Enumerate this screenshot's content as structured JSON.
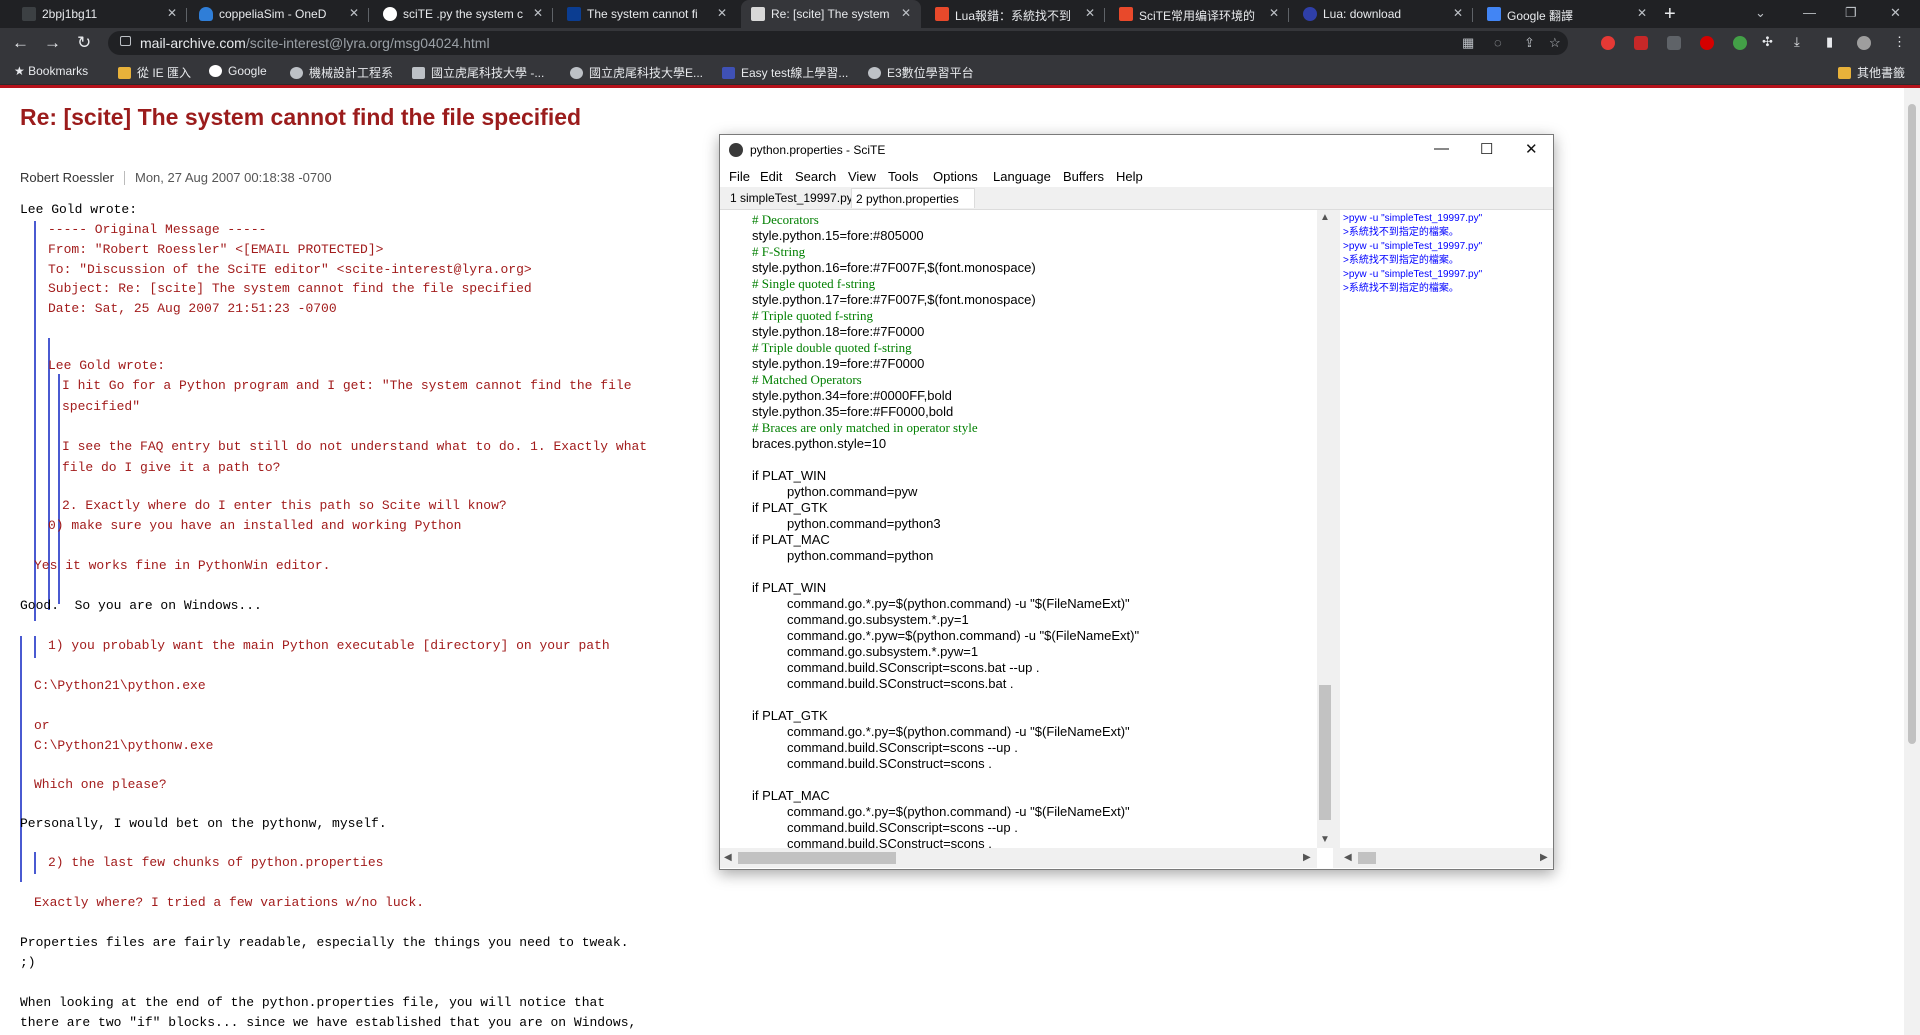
{
  "browser": {
    "tabs": [
      {
        "title": "2bpj1bg11",
        "close": "✕"
      },
      {
        "title": "coppeliaSim - OneD",
        "close": "✕"
      },
      {
        "title": "sciTE .py the system c",
        "close": "✕"
      },
      {
        "title": "The system cannot fi",
        "close": "✕"
      },
      {
        "title": "Re: [scite] The system",
        "close": "✕"
      },
      {
        "title": "Lua報錯：系統找不到",
        "close": "✕"
      },
      {
        "title": "SciTE常用编译环境的",
        "close": "✕"
      },
      {
        "title": "Lua: download",
        "close": "✕"
      },
      {
        "title": "Google 翻譯",
        "close": "✕"
      }
    ],
    "new_tab": "+",
    "url_host": "mail-archive.com",
    "url_path": "/scite-interest@lyra.org/msg04024.html",
    "bookmarks": [
      {
        "label": "Bookmarks"
      },
      {
        "label": "從 IE 匯入"
      },
      {
        "label": "Google"
      },
      {
        "label": "機械設計工程系"
      },
      {
        "label": "國立虎尾科技大學 -..."
      },
      {
        "label": "國立虎尾科技大學E..."
      },
      {
        "label": "Easy test線上學習..."
      },
      {
        "label": "E3數位學習平台"
      },
      {
        "label": "其他書籤"
      }
    ],
    "colors": {
      "chrome_dark": "#202124",
      "toolbar": "#35363a",
      "accent_red": "#b5121b"
    }
  },
  "page": {
    "title": "Re: [scite] The system cannot find the file specified",
    "author": "Robert Roessler",
    "date": "Mon, 27 Aug 2007 00:18:38 -0700",
    "lines": [
      "Lee Gold wrote:",
      "----- Original Message -----",
      "From: \"Robert Roessler\" <[EMAIL PROTECTED]>",
      "To: \"Discussion of the SciTE editor\" <scite-interest@lyra.org>",
      "Subject: Re: [scite] The system cannot find the file specified",
      "Date: Sat, 25 Aug 2007 21:51:23 -0700",
      "Lee Gold wrote:",
      "I hit Go for a Python program and I get: \"The system cannot find the file",
      "specified\"",
      "I see the FAQ entry but still do not understand what to do. 1. Exactly what",
      "file do I give it a path to?",
      "2. Exactly where do I enter this path so Scite will know?",
      "0) make sure you have an installed and working Python",
      "Yes it works fine in PythonWin editor.",
      "Good.  So you are on Windows...",
      "1) you probably want the main Python executable [directory] on your path",
      "C:\\Python21\\python.exe",
      "or",
      "C:\\Python21\\pythonw.exe",
      "Which one please?",
      "Personally, I would bet on the pythonw, myself.",
      "2) the last few chunks of python.properties",
      "Exactly where? I tried a few variations w/no luck.",
      "Properties files are fairly readable, especially the things you need to tweak.",
      ";)",
      "When looking at the end of the python.properties file, you will notice that",
      "there are two \"if\" blocks... since we have established that you are on Windows,"
    ]
  },
  "scite": {
    "window_title": "python.properties - SciTE",
    "menu": [
      "File",
      "Edit",
      "Search",
      "View",
      "Tools",
      "Options",
      "Language",
      "Buffers",
      "Help"
    ],
    "tabs": [
      "1 simpleTest_19997.py",
      "2 python.properties"
    ],
    "code_lines": [
      {
        "text": "# Decorators",
        "type": "comment"
      },
      {
        "text": "style.python.15=fore:#805000",
        "type": "code"
      },
      {
        "text": "# F-String",
        "type": "comment"
      },
      {
        "text": "style.python.16=fore:#7F007F,$(font.monospace)",
        "type": "code"
      },
      {
        "text": "# Single quoted f-string",
        "type": "comment"
      },
      {
        "text": "style.python.17=fore:#7F007F,$(font.monospace)",
        "type": "code"
      },
      {
        "text": "# Triple quoted f-string",
        "type": "comment"
      },
      {
        "text": "style.python.18=fore:#7F0000",
        "type": "code"
      },
      {
        "text": "# Triple double quoted f-string",
        "type": "comment"
      },
      {
        "text": "style.python.19=fore:#7F0000",
        "type": "code"
      },
      {
        "text": "# Matched Operators",
        "type": "comment"
      },
      {
        "text": "style.python.34=fore:#0000FF,bold",
        "type": "code"
      },
      {
        "text": "style.python.35=fore:#FF0000,bold",
        "type": "code"
      },
      {
        "text": "# Braces are only matched in operator style",
        "type": "comment"
      },
      {
        "text": "braces.python.style=10",
        "type": "code"
      },
      {
        "text": "",
        "type": "blank"
      },
      {
        "text": "if PLAT_WIN",
        "type": "code"
      },
      {
        "text": "python.command=pyw",
        "type": "indent"
      },
      {
        "text": "if PLAT_GTK",
        "type": "code"
      },
      {
        "text": "python.command=python3",
        "type": "indent"
      },
      {
        "text": "if PLAT_MAC",
        "type": "code"
      },
      {
        "text": "python.command=python",
        "type": "indent"
      },
      {
        "text": "",
        "type": "blank"
      },
      {
        "text": "if PLAT_WIN",
        "type": "code"
      },
      {
        "text": "command.go.*.py=$(python.command) -u \"$(FileNameExt)\"",
        "type": "indent"
      },
      {
        "text": "command.go.subsystem.*.py=1",
        "type": "indent"
      },
      {
        "text": "command.go.*.pyw=$(python.command) -u \"$(FileNameExt)\"",
        "type": "indent"
      },
      {
        "text": "command.go.subsystem.*.pyw=1",
        "type": "indent"
      },
      {
        "text": "command.build.SConscript=scons.bat --up .",
        "type": "indent"
      },
      {
        "text": "command.build.SConstruct=scons.bat .",
        "type": "indent"
      },
      {
        "text": "",
        "type": "blank"
      },
      {
        "text": "if PLAT_GTK",
        "type": "code"
      },
      {
        "text": "command.go.*.py=$(python.command) -u \"$(FileNameExt)\"",
        "type": "indent"
      },
      {
        "text": "command.build.SConscript=scons --up .",
        "type": "indent"
      },
      {
        "text": "command.build.SConstruct=scons .",
        "type": "indent"
      },
      {
        "text": "",
        "type": "blank"
      },
      {
        "text": "if PLAT_MAC",
        "type": "code"
      },
      {
        "text": "command.go.*.py=$(python.command) -u \"$(FileNameExt)\"",
        "type": "indent"
      },
      {
        "text": "command.build.SConscript=scons --up .",
        "type": "indent"
      },
      {
        "text": "command.build.SConstruct=scons .",
        "type": "indent"
      }
    ],
    "output_lines": [
      ">pyw -u \"simpleTest_19997.py\"",
      ">系統找不到指定的檔案。",
      ">pyw -u \"simpleTest_19997.py\"",
      ">系統找不到指定的檔案。",
      ">pyw -u \"simpleTest_19997.py\"",
      ">系統找不到指定的檔案。"
    ],
    "colors": {
      "comment": "#007f00",
      "output": "#0000ff"
    }
  }
}
